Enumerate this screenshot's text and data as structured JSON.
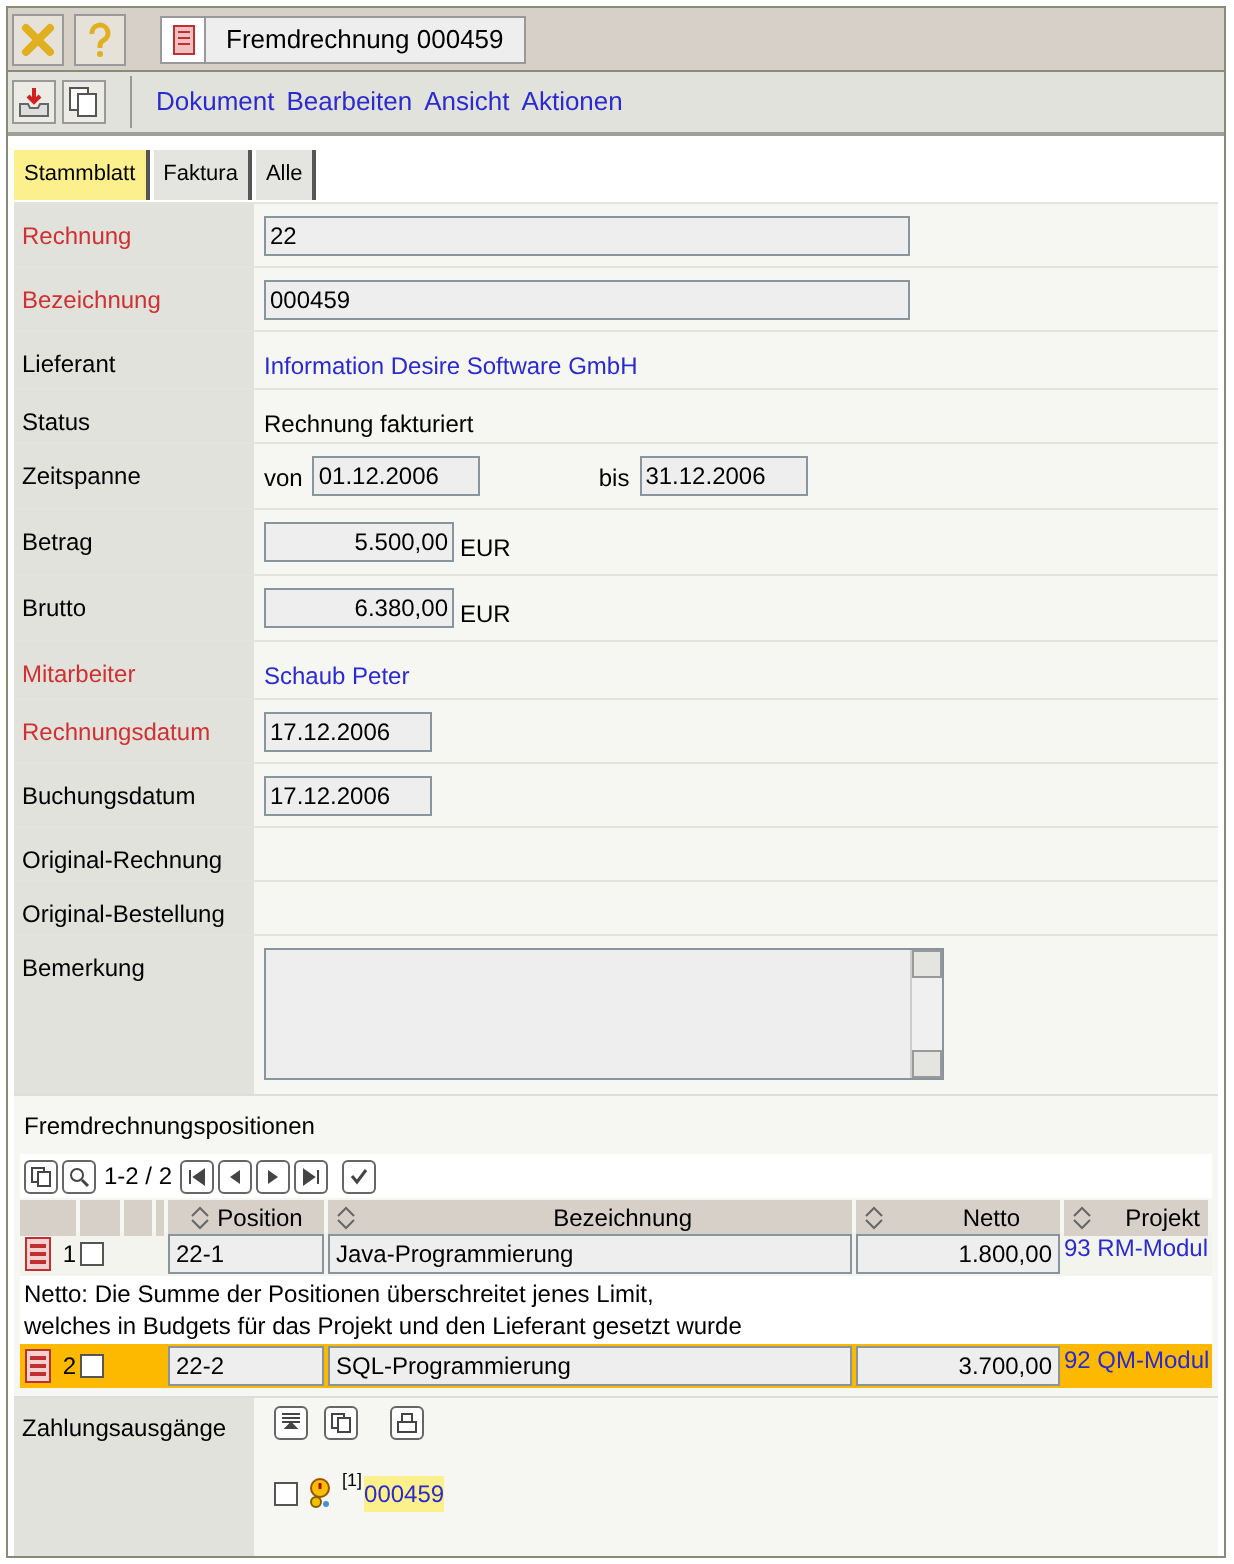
{
  "window": {
    "title": "Fremdrechnung 000459"
  },
  "menu": [
    "Dokument",
    "Bearbeiten",
    "Ansicht",
    "Aktionen"
  ],
  "tabs": [
    {
      "label": "Stammblatt",
      "selected": true
    },
    {
      "label": "Faktura",
      "selected": false
    },
    {
      "label": "Alle",
      "selected": false
    }
  ],
  "fields": [
    {
      "kind": "input",
      "label": "Rechnung",
      "required": true,
      "value": "22"
    },
    {
      "kind": "input",
      "label": "Bezeichnung",
      "required": true,
      "value": "000459"
    },
    {
      "kind": "link",
      "label": "Lieferant",
      "required": false,
      "value": "Information Desire Software GmbH"
    },
    {
      "kind": "text",
      "label": "Status",
      "required": false,
      "value": "Rechnung fakturiert"
    },
    {
      "kind": "range",
      "label": "Zeitspanne",
      "required": false,
      "from_label": "von",
      "from": "01.12.2006",
      "to_label": "bis",
      "to": "31.12.2006"
    },
    {
      "kind": "amount",
      "label": "Betrag",
      "required": false,
      "value": "5.500,00",
      "unit": "EUR"
    },
    {
      "kind": "amount",
      "label": "Brutto",
      "required": false,
      "value": "6.380,00",
      "unit": "EUR"
    },
    {
      "kind": "link",
      "label": "Mitarbeiter",
      "required": true,
      "value": "Schaub Peter"
    },
    {
      "kind": "date",
      "label": "Rechnungsdatum",
      "required": true,
      "value": "17.12.2006"
    },
    {
      "kind": "date",
      "label": "Buchungsdatum",
      "required": false,
      "value": "17.12.2006"
    },
    {
      "kind": "empty",
      "label": "Original-Rechnung",
      "required": false
    },
    {
      "kind": "empty",
      "label": "Original-Bestellung",
      "required": false
    },
    {
      "kind": "textarea",
      "label": "Bemerkung",
      "required": false
    }
  ],
  "positions": {
    "title": "Fremdrechnungspositionen",
    "pager": "1-2 / 2",
    "columns": [
      "Position",
      "Bezeichnung",
      "Netto",
      "Projekt"
    ],
    "rows": [
      {
        "number": "1",
        "selected": false,
        "checked": false,
        "position": "22-1",
        "bezeichnung": "Java-Programmierung",
        "netto": "1.800,00",
        "projekt": "93 RM-Modul",
        "note": "Netto: Die Summe der Positionen überschreitet jenes Limit,\nwelches in Budgets für das Projekt und den Lieferant gesetzt wurde"
      },
      {
        "number": "2",
        "selected": true,
        "checked": false,
        "position": "22-2",
        "bezeichnung": "SQL-Programmierung",
        "netto": "3.700,00",
        "projekt": "92 QM-Modul"
      }
    ]
  },
  "payments": {
    "label": "Zahlungsausgänge",
    "items": [
      {
        "checked": false,
        "index": "[1]",
        "link": "000459"
      }
    ]
  }
}
